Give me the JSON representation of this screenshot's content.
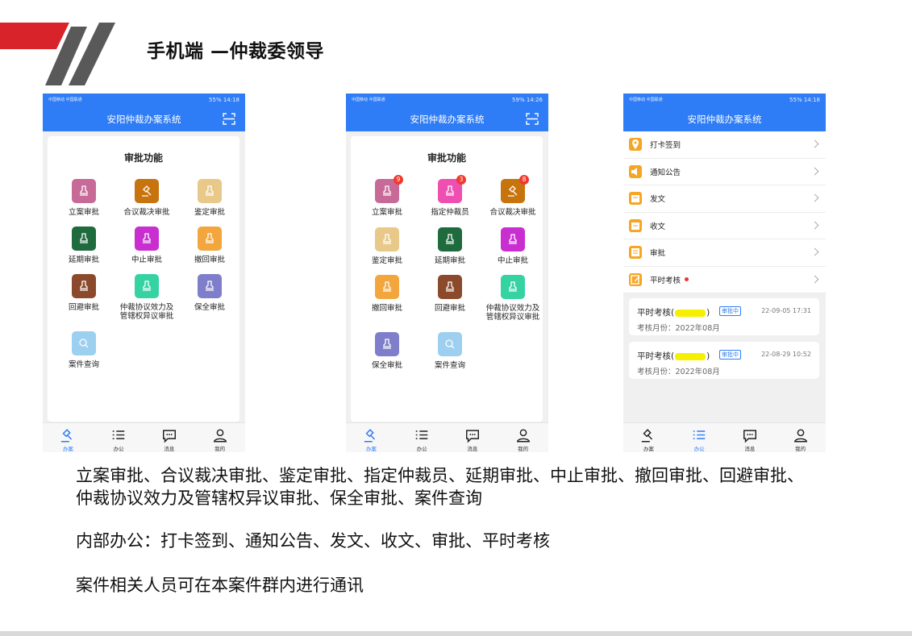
{
  "slide": {
    "title": "手机端 —仲裁委领导",
    "descriptions": [
      "立案审批、合议裁决审批、鉴定审批、指定仲裁员、延期审批、中止审批、撤回审批、回避审批、",
      "仲裁协议效力及管辖权异议审批、保全审批、案件查询",
      "内部办公：打卡签到、通知公告、发文、收文、审批、平时考核",
      "案件相关人员可在本案件群内进行通讯"
    ]
  },
  "phone1": {
    "status_left": "中国移动 中国联通",
    "status_right": "55% 14:18",
    "app_title": "安阳仲裁办案系统",
    "card_title": "审批功能",
    "items": [
      {
        "label": "立案审批",
        "color": "#c86a98"
      },
      {
        "label": "合议裁决审批",
        "color": "#c8740e"
      },
      {
        "label": "鉴定审批",
        "color": "#e8c98a"
      },
      {
        "label": "延期审批",
        "color": "#1f6b3e"
      },
      {
        "label": "中止审批",
        "color": "#c92fd0"
      },
      {
        "label": "撤回审批",
        "color": "#f3a63d"
      },
      {
        "label": "回避审批",
        "color": "#8b4a2b"
      },
      {
        "label": "仲裁协议效力及",
        "label2": "管辖权异议审批",
        "color": "#36d3a2"
      },
      {
        "label": "保全审批",
        "color": "#7f7ecb"
      },
      {
        "label": "案件查询",
        "color": "#9ccff0"
      }
    ],
    "tabs": [
      {
        "label": "办案",
        "icon": "gavel-icon"
      },
      {
        "label": "办公",
        "icon": "list-icon"
      },
      {
        "label": "消息",
        "icon": "message-icon"
      },
      {
        "label": "我的",
        "icon": "user-icon"
      }
    ]
  },
  "phone2": {
    "status_left": "中国移动 中国联通",
    "status_right": "59% 14:26",
    "app_title": "安阳仲裁办案系统",
    "card_title": "审批功能",
    "items": [
      {
        "label": "立案审批",
        "color": "#c86a98",
        "badge": "9"
      },
      {
        "label": "指定仲裁员",
        "color": "#ef4fb0",
        "badge": "3"
      },
      {
        "label": "合议裁决审批",
        "color": "#c8740e",
        "badge": "8"
      },
      {
        "label": "鉴定审批",
        "color": "#e8c98a"
      },
      {
        "label": "延期审批",
        "color": "#1f6b3e"
      },
      {
        "label": "中止审批",
        "color": "#c92fd0"
      },
      {
        "label": "撤回审批",
        "color": "#f3a63d"
      },
      {
        "label": "回避审批",
        "color": "#8b4a2b"
      },
      {
        "label": "仲裁协议效力及",
        "label2": "管辖权异议审批",
        "color": "#36d3a2"
      },
      {
        "label": "保全审批",
        "color": "#7f7ecb"
      },
      {
        "label": "案件查询",
        "color": "#9ccff0"
      }
    ],
    "tabs": [
      {
        "label": "办案",
        "icon": "gavel-icon"
      },
      {
        "label": "办公",
        "icon": "list-icon"
      },
      {
        "label": "消息",
        "icon": "message-icon"
      },
      {
        "label": "我的",
        "icon": "user-icon"
      }
    ]
  },
  "phone3": {
    "status_left": "中国移动 中国联通",
    "status_right": "55% 14:18",
    "app_title": "安阳仲裁办案系统",
    "menu": [
      {
        "label": "打卡签到",
        "icon": "location-icon"
      },
      {
        "label": "通知公告",
        "icon": "speaker-icon"
      },
      {
        "label": "发文",
        "icon": "send-doc-icon"
      },
      {
        "label": "收文",
        "icon": "receive-doc-icon"
      },
      {
        "label": "审批",
        "icon": "approval-icon"
      },
      {
        "label": "平时考核",
        "icon": "edit-icon",
        "dot": true
      }
    ],
    "reviews": [
      {
        "title_prefix": "平时考核(",
        "title_suffix": ")",
        "tag": "审批中",
        "time": "22-09-05 17:31",
        "month": "考核月份：2022年08月"
      },
      {
        "title_prefix": "平时考核(",
        "title_suffix": ")",
        "tag": "审批中",
        "time": "22-08-29 10:52",
        "month": "考核月份：2022年08月"
      }
    ],
    "tabs": [
      {
        "label": "办案",
        "icon": "gavel-icon"
      },
      {
        "label": "办公",
        "icon": "list-icon"
      },
      {
        "label": "消息",
        "icon": "message-icon"
      },
      {
        "label": "我的",
        "icon": "user-icon"
      }
    ]
  },
  "colors": {
    "primary": "#2e7cf6",
    "accent_red": "#d9232b",
    "menu_icon": "#f5a623"
  }
}
